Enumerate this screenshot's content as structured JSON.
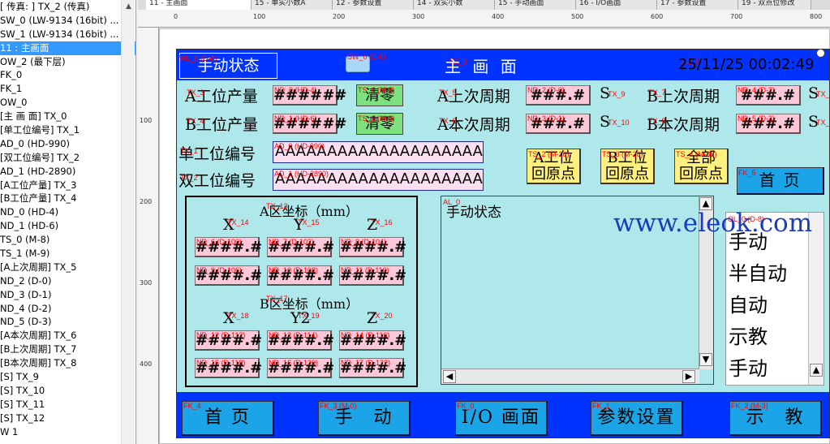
{
  "tree": {
    "items": [
      "[ 传真: ] TX_2 (传真)",
      "SW_0 (LW-9134 (16bit) ...",
      "SW_1 (LW-9134 (16bit) ...",
      "11 : 主画面",
      "OW_2 (最下层)",
      "FK_0",
      "FK_1",
      "OW_0",
      "[主 画 面] TX_0",
      "[单工位编号] TX_1",
      "AD_0 (HD-990)",
      "[双工位编号] TX_2",
      "AD_1 (HD-2890)",
      "[A工位产量] TX_3",
      "[B工位产量] TX_4",
      "ND_0 (HD-4)",
      "ND_1 (HD-6)",
      "TS_0 (M-8)",
      "TS_1 (M-9)",
      "[A上次周期] TX_5",
      "ND_2 (D-0)",
      "ND_3 (D-1)",
      "ND_4 (D-2)",
      "ND_5 (D-3)",
      "[A本次周期] TX_6",
      "[B上次周期] TX_7",
      "[B本次周期] TX_8",
      "[S] TX_9",
      "[S] TX_10",
      "[S] TX_11",
      "[S] TX_12",
      "W 1"
    ],
    "selected_index": 3
  },
  "tabs": [
    "11 - 主画面",
    "15 - 单实小数A",
    "12 - 参数设置",
    "14 - 双实小数",
    "15 - 手动画面",
    "16 - I/O画面",
    "17 - 参数设置",
    "19 - 双点位修改"
  ],
  "ruler": {
    "top": [
      "0",
      "100",
      "200",
      "300",
      "400",
      "500",
      "600",
      "700",
      "800"
    ],
    "left": [
      "100",
      "200",
      "300",
      "400"
    ]
  },
  "hmi": {
    "status_title": "手动状态",
    "page_title": "主 画 面",
    "datetime": "25/11/25 00:02:49",
    "tags": {
      "wl": "WL_0 (D-8)",
      "sw0": "SW_0 (D-8)",
      "tx0": "TX_0",
      "dc": "DC_0",
      "tx3": "TX_3",
      "nd0": "ND_0 (HD-4)",
      "ts0": "TS_0 (M-8)",
      "tx5": "TX_5",
      "nd2": "ND_2 (D-0)",
      "tx9": "TX_9",
      "tx7": "TX_7",
      "nd4": "ND_4 (D-2)",
      "tx11": "TX_1",
      "tx4": "TX_4",
      "nd1": "ND_1 (HD-6)",
      "ts1": "TS_1 (M-9)",
      "tx6": "TX_6",
      "nd3": "ND_3 (D-1)",
      "tx10": "TX_10",
      "tx8": "TX_8",
      "nd5": "ND_5 (D-3)",
      "tx12": "TX_1",
      "tx1": "TX_1",
      "ad0": "AD_0 (HD-990)",
      "tx2": "TX_2",
      "ad1": "AD_1 (HD-2890)",
      "ts2": "TS_2 (M-16)",
      "ts3": "TS_3 (M-26)",
      "ts4": "TS_4 (M-36)",
      "fk5": "FK_5",
      "tx13": "TX_13",
      "tx14": "TX_14",
      "tx15": "TX_15",
      "tx16": "TX_16",
      "ndx1": "ND_6 (D-100)",
      "ndy1": "ND_7 (D-102)",
      "ndz1": "ND_8 (D-104)",
      "ndx2": "ND_9 (D-106)",
      "ndy2": "ND_10 (D-108)",
      "ndz2": "ND_11 (D-110)",
      "tx17": "TX_17",
      "tx18": "TX_18",
      "tx19": "TX_19",
      "tx20": "TX_20",
      "ndx3": "ND_12 (D-112)",
      "ndy3": "ND_13 (D-114)",
      "ndz3": "ND_14 (D-116)",
      "ndx4": "ND_15 (D-118)",
      "ndy4": "ND_16 (D-120)",
      "ndz4": "ND_17 (D-122)",
      "al0": "AL_0",
      "ol0": "OL_0 (D-8)",
      "fk4": "FK_4",
      "fk3": "FK_3 (M-0)",
      "fk0": "FK_0",
      "fk1": "FK_1",
      "fk2": "FK_2 (M-3)"
    },
    "labels": {
      "a_output": "A工位产量",
      "b_output": "B工位产量",
      "a_last": "A上次周期",
      "a_this": "A本次周期",
      "b_last": "B上次周期",
      "b_this": "B本次周期",
      "s": "S",
      "single_no": "单工位编号",
      "double_no": "双工位编号"
    },
    "values": {
      "int_mask": "######",
      "dec_mask": "###.#",
      "coord_mask": "####.#",
      "ascii": "AAAAAAAAAAAAAAAAAAAA"
    },
    "clear_label": "清零",
    "home_buttons": {
      "a": [
        "A工位",
        "回原点"
      ],
      "b": [
        "B工位",
        "回原点"
      ],
      "all": [
        "全部",
        "回原点"
      ]
    },
    "home_button": "首 页",
    "coord": {
      "a_title": "A区坐标（mm）",
      "b_title": "B区坐标（mm）",
      "x": "X",
      "y": "Y",
      "z": "Z",
      "x2": "X",
      "y2": "Y2",
      "z2": "Z"
    },
    "alarm_text": "手动状态",
    "modes": [
      "手动",
      "半自动",
      "自动",
      "示教",
      "手动"
    ],
    "watermark": "www.eleok.com",
    "footer": [
      "首 页",
      "手　动",
      "I/O 画面",
      "参数设置",
      "示　教"
    ]
  }
}
